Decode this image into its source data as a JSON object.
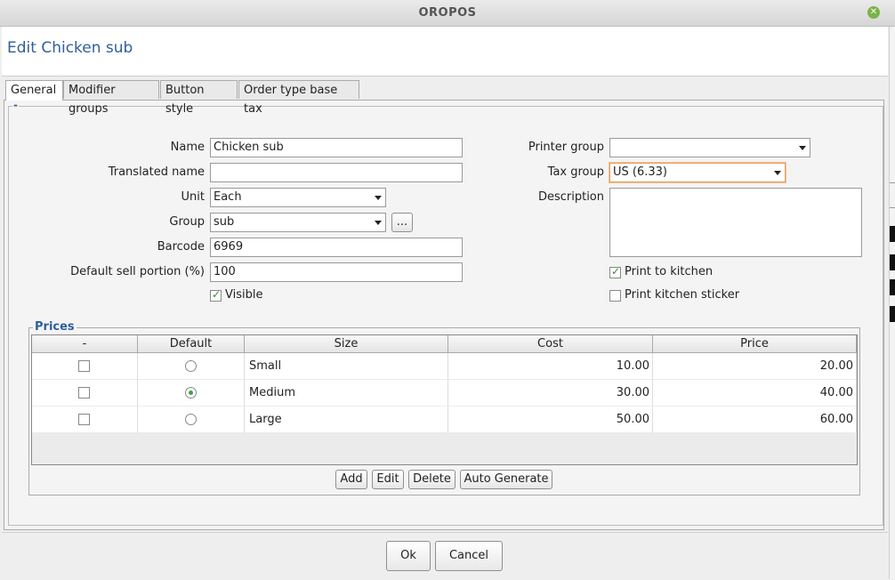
{
  "window": {
    "title": "OROPOS"
  },
  "header": {
    "title": "Edit Chicken sub"
  },
  "tabs": [
    "General",
    "Modifier groups",
    "Button style",
    "Order type base tax"
  ],
  "panel": {
    "dash": "-"
  },
  "form": {
    "name_label": "Name",
    "name_value": "Chicken sub",
    "translated_label": "Translated name",
    "translated_value": "",
    "unit_label": "Unit",
    "unit_value": "Each",
    "group_label": "Group",
    "group_value": "sub",
    "group_more": "...",
    "barcode_label": "Barcode",
    "barcode_value": "6969",
    "portion_label": "Default sell portion (%)",
    "portion_value": "100",
    "visible_label": "Visible",
    "visible_checked": true,
    "printer_group_label": "Printer group",
    "printer_group_value": "",
    "tax_group_label": "Tax group",
    "tax_group_value": "US (6.33)",
    "description_label": "Description",
    "description_value": "",
    "print_kitchen_label": "Print to kitchen",
    "print_kitchen_checked": true,
    "print_sticker_label": "Print kitchen sticker",
    "print_sticker_checked": false
  },
  "prices": {
    "title": "Prices",
    "columns": [
      "-",
      "Default",
      "Size",
      "Cost",
      "Price"
    ],
    "rows": [
      {
        "size": "Small",
        "cost": "10.00",
        "price": "20.00",
        "default": false
      },
      {
        "size": "Medium",
        "cost": "30.00",
        "price": "40.00",
        "default": true
      },
      {
        "size": "Large",
        "cost": "50.00",
        "price": "60.00",
        "default": false
      }
    ],
    "buttons": {
      "add": "Add",
      "edit": "Edit",
      "delete": "Delete",
      "auto": "Auto Generate"
    }
  },
  "footer": {
    "ok": "Ok",
    "cancel": "Cancel"
  }
}
